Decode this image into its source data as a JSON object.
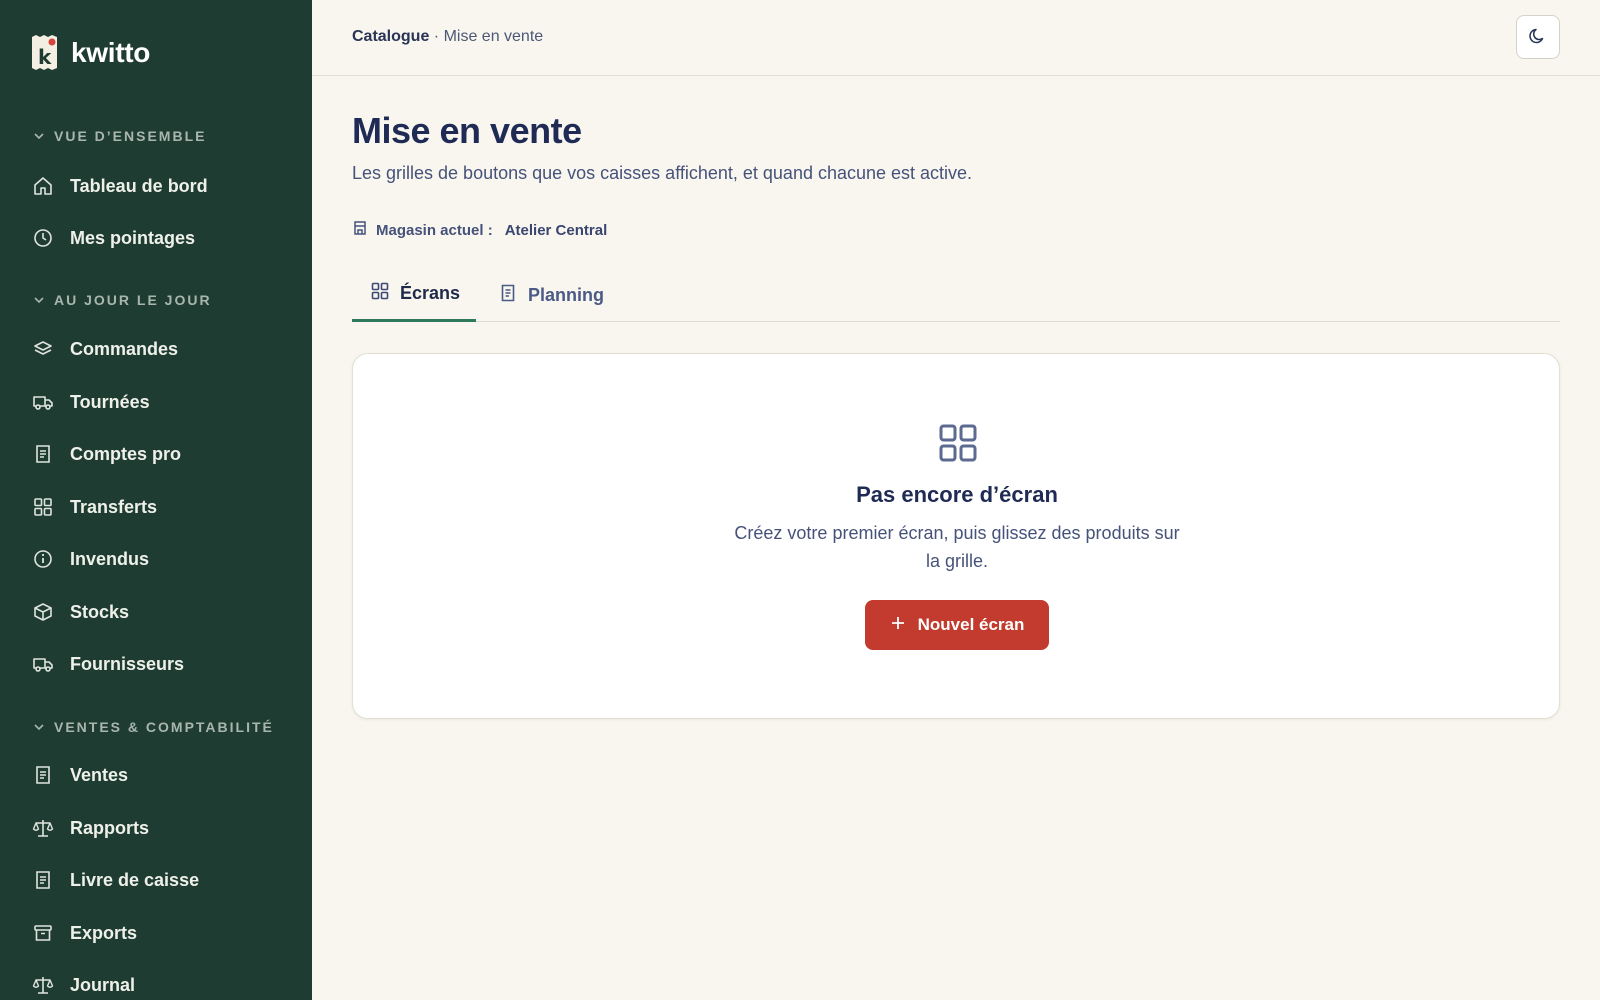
{
  "brand": {
    "name": "kwitto",
    "logo_letter": "k"
  },
  "sidebar": {
    "sections": [
      {
        "label": "VUE D’ENSEMBLE"
      },
      {
        "label": "AU JOUR LE JOUR"
      },
      {
        "label": "VENTES & COMPTABILITÉ"
      }
    ],
    "items": [
      {
        "label": "Tableau de bord",
        "icon": "home-icon"
      },
      {
        "label": "Mes pointages",
        "icon": "clock-icon"
      },
      {
        "label": "Commandes",
        "icon": "layers-icon"
      },
      {
        "label": "Tournées",
        "icon": "truck-icon"
      },
      {
        "label": "Comptes pro",
        "icon": "receipt-icon"
      },
      {
        "label": "Transferts",
        "icon": "grid-icon"
      },
      {
        "label": "Invendus",
        "icon": "info-icon"
      },
      {
        "label": "Stocks",
        "icon": "box-icon"
      },
      {
        "label": "Fournisseurs",
        "icon": "truck-icon"
      },
      {
        "label": "Ventes",
        "icon": "receipt-icon"
      },
      {
        "label": "Rapports",
        "icon": "scale-icon"
      },
      {
        "label": "Livre de caisse",
        "icon": "receipt-icon"
      },
      {
        "label": "Exports",
        "icon": "archive-icon"
      },
      {
        "label": "Journal",
        "icon": "scale-icon"
      }
    ]
  },
  "header": {
    "breadcrumb_root": "Catalogue",
    "breadcrumb_sep": " · ",
    "breadcrumb_current": "Mise en vente",
    "theme_toggle_icon": "moon-icon"
  },
  "page": {
    "title": "Mise en vente",
    "subtitle": "Les grilles de boutons que vos caisses affichent, et quand chacune est active.",
    "store_label": "Magasin actuel :",
    "store_value": "Atelier Central"
  },
  "tabs": [
    {
      "label": "Écrans",
      "active": true,
      "icon": "grid-icon"
    },
    {
      "label": "Planning",
      "active": false,
      "icon": "document-icon"
    }
  ],
  "empty_state": {
    "title": "Pas encore d’écran",
    "description": "Créez votre premier écran, puis glissez des produits sur la grille.",
    "button_label": "Nouvel écran"
  },
  "colors": {
    "sidebar_bg": "#1f3c33",
    "page_bg": "#f8f6ef",
    "accent_green": "#2f7a5c",
    "primary_red": "#c33a2e",
    "text_navy": "#1f2a55"
  }
}
